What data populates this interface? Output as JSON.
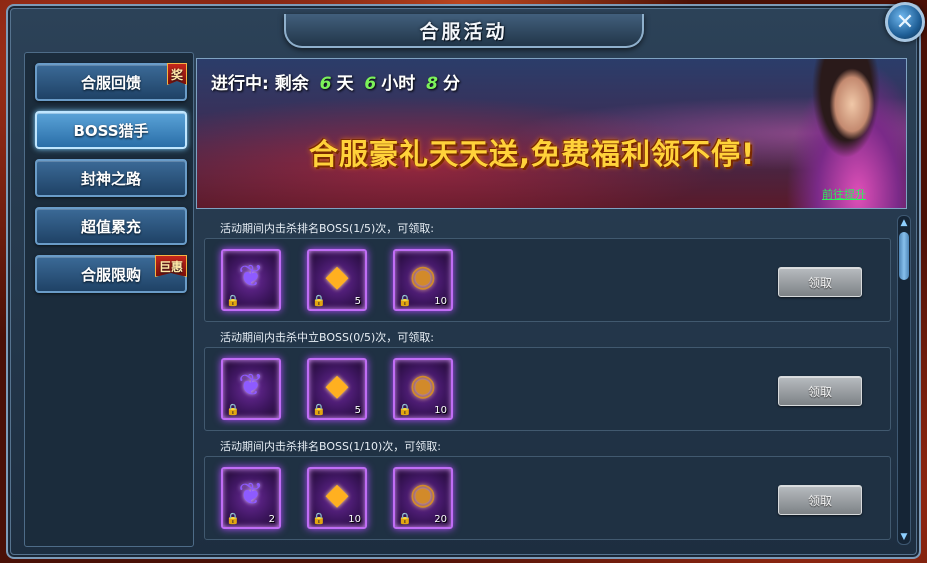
{
  "window": {
    "title": "合服活动",
    "close_glyph": "✕"
  },
  "sidebar": {
    "items": [
      {
        "label": "合服回馈",
        "badge": "奖",
        "active": false
      },
      {
        "label": "BOSS猎手",
        "badge": "",
        "active": true
      },
      {
        "label": "封神之路",
        "badge": "",
        "active": false
      },
      {
        "label": "超值累充",
        "badge": "",
        "active": false
      },
      {
        "label": "合服限购",
        "badge": "巨惠",
        "active": false
      }
    ]
  },
  "banner": {
    "progress_prefix": "进行中: 剩余",
    "days": "6",
    "days_unit": "天",
    "hours": "6",
    "hours_unit": "小时",
    "minutes": "8",
    "minutes_unit": "分",
    "slogan": "合服豪礼天天送,免费福利领不停!",
    "link": "前往提升"
  },
  "tasks": [
    {
      "header": "活动期间内击杀排名BOSS(1/5)次，可领取:",
      "items": [
        {
          "icon": "purple-pouch-icon",
          "count": ""
        },
        {
          "icon": "gold-crystal-icon",
          "count": "5"
        },
        {
          "icon": "copper-coin-icon",
          "count": "10"
        }
      ],
      "button": "领取"
    },
    {
      "header": "活动期间内击杀中立BOSS(0/5)次，可领取:",
      "items": [
        {
          "icon": "purple-pouch-icon",
          "count": ""
        },
        {
          "icon": "gold-crystal-icon",
          "count": "5"
        },
        {
          "icon": "copper-coin-icon",
          "count": "10"
        }
      ],
      "button": "领取"
    },
    {
      "header": "活动期间内击杀排名BOSS(1/10)次，可领取:",
      "items": [
        {
          "icon": "purple-pouch-icon",
          "count": "2"
        },
        {
          "icon": "gold-crystal-icon",
          "count": "10"
        },
        {
          "icon": "copper-coin-icon",
          "count": "20"
        }
      ],
      "button": "领取"
    }
  ],
  "colors": {
    "accent_green": "#7cf25a",
    "slogan_gold": "#ffd23a",
    "item_glow": "#b24cff"
  }
}
